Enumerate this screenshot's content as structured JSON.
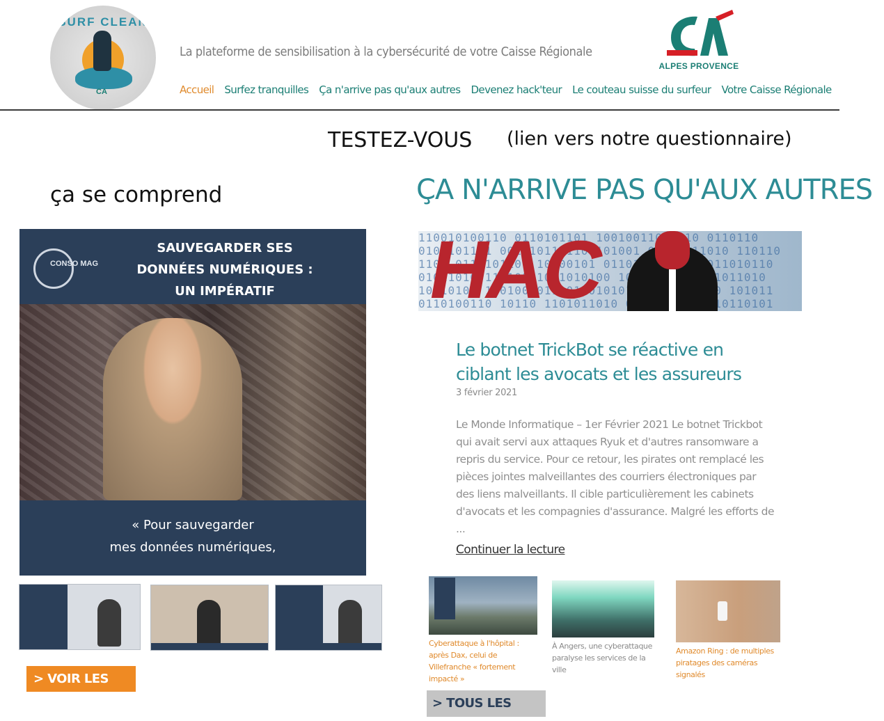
{
  "header": {
    "logo_text": "SURF CLEAN",
    "logo_mini": "CA",
    "tagline": "La plateforme de sensibilisation à la cybersécurité de votre Caisse Régionale",
    "bank_name": "ALPES PROVENCE",
    "brand_color": "#1b7e74",
    "active_color": "#e08a2c",
    "nav": [
      {
        "label": "Accueil",
        "active": true
      },
      {
        "label": "Surfez tranquilles",
        "active": false
      },
      {
        "label": "Ça n'arrive pas qu'aux autres",
        "active": false
      },
      {
        "label": "Devenez hack'teur",
        "active": false
      },
      {
        "label": "Le couteau suisse du surfeur",
        "active": false
      },
      {
        "label": "Votre Caisse Régionale",
        "active": false
      }
    ]
  },
  "test": {
    "title": "TESTEZ-VOUS",
    "link_text": "(lien vers notre questionnaire)"
  },
  "left": {
    "heading": "ça se comprend",
    "video": {
      "brand": "CONSO MAG",
      "title_lines": [
        "SAUVEGARDER SES",
        "DONNÉES NUMÉRIQUES :",
        "UN IMPÉRATIF"
      ],
      "caption_lines": [
        "« Pour sauvegarder",
        "mes données numériques,"
      ]
    },
    "thumbnails": [
      "video-thumbnail-1",
      "video-thumbnail-2",
      "video-thumbnail-3"
    ],
    "button_label": "> VOIR LES VIDÉOS",
    "button_color": "#ef8a23"
  },
  "right": {
    "section_title": "ÇA N'ARRIVE PAS QU'AUX AUTRES",
    "hero_text": "HAC",
    "article": {
      "title": "Le botnet TrickBot se réactive en ciblant les avocats et les assureurs",
      "date": "3 février 2021",
      "excerpt": "Le Monde Informatique – 1er Février 2021 Le botnet Trickbot qui avait servi aux attaques Ryuk et d'autres ransomware a repris du service. Pour ce retour, les pirates ont remplacé les pièces jointes malveillantes des courriers électroniques par des liens malveillants. Il cible particulièrement les cabinets d'avocats et les compagnies d'assurance. Malgré les efforts de ...",
      "read_more": "Continuer la lecture"
    },
    "related": [
      {
        "caption": "Cyberattaque à l'hôpital : après Dax, celui de Villefranche « fortement impacté »"
      },
      {
        "caption": "À Angers, une cyberattaque paralyse les services de la ville"
      },
      {
        "caption": "Amazon Ring : de multiples piratages des caméras signalés"
      }
    ],
    "button_label": "> TOUS LES ARTICLES",
    "accent_color": "#2d8c95"
  }
}
